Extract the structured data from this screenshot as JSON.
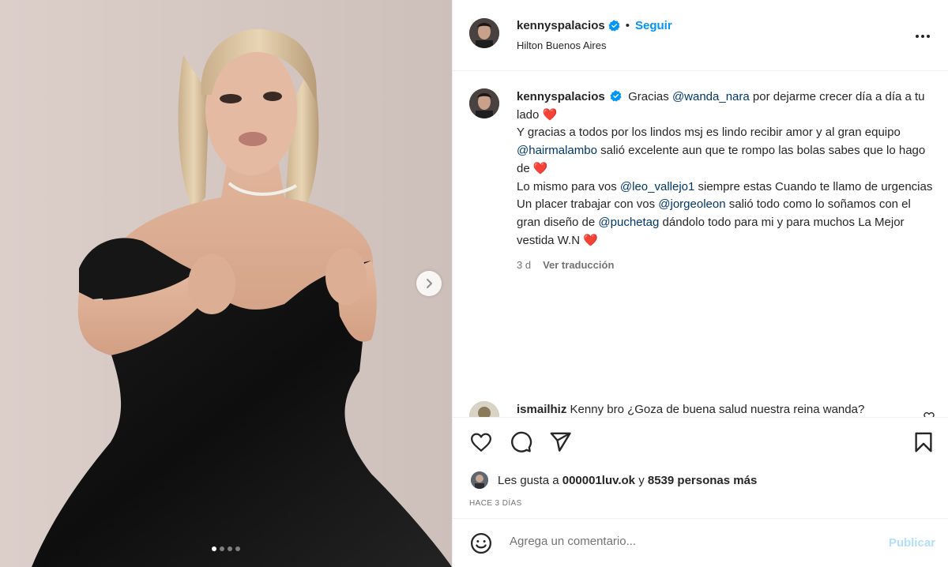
{
  "post": {
    "author": {
      "username": "kennyspalacios",
      "verified": true,
      "follow_label": "Seguir",
      "location": "Hilton Buenos Aires",
      "separator": "•"
    },
    "caption": {
      "username": "kennyspalacios",
      "segments": [
        {
          "type": "text",
          "value": "Gracias "
        },
        {
          "type": "mention",
          "value": "@wanda_nara"
        },
        {
          "type": "text",
          "value": " por dejarme crecer día a día a tu lado "
        },
        {
          "type": "emoji",
          "value": "❤️"
        },
        {
          "type": "br"
        },
        {
          "type": "text",
          "value": "Y gracias a todos por los lindos msj es lindo recibir amor y al gran equipo"
        },
        {
          "type": "br"
        },
        {
          "type": "mention",
          "value": "@hairmalambo"
        },
        {
          "type": "text",
          "value": " salió excelente aun que te rompo las bolas sabes que lo hago de "
        },
        {
          "type": "emoji",
          "value": "❤️"
        },
        {
          "type": "br"
        },
        {
          "type": "text",
          "value": "Lo mismo para vos "
        },
        {
          "type": "mention",
          "value": "@leo_vallejo1"
        },
        {
          "type": "text",
          "value": " siempre estas Cuando te llamo de urgencias"
        },
        {
          "type": "br"
        },
        {
          "type": "text",
          "value": "Un placer trabajar con vos "
        },
        {
          "type": "mention",
          "value": "@jorgeoleon"
        },
        {
          "type": "text",
          "value": " salió todo como lo soñamos con el gran diseño de "
        },
        {
          "type": "mention",
          "value": "@puchetag"
        },
        {
          "type": "text",
          "value": " dándolo todo para mi y para muchos La Mejor vestida W.N "
        },
        {
          "type": "emoji",
          "value": "❤️"
        }
      ],
      "age": "3 d",
      "see_translation": "Ver traducción"
    },
    "comments": [
      {
        "username": "ismailhiz",
        "text": "Kenny bro ¿Goza de buena salud nuestra reina wanda? Estamos muy emocionados por las noticias escritas en la prensa.... Deseamos mucha salud a nuestra Reina... La queremos mucho a ella y a los niños... Que Dios le de salud..."
      }
    ],
    "likes": {
      "prefix": "Les gusta a ",
      "first_user": "000001luv.ok",
      "middle": " y ",
      "others": "8539 personas más"
    },
    "time_ago": "HACE 3 DÍAS",
    "add_comment": {
      "placeholder": "Agrega un comentario...",
      "post_label": "Publicar"
    },
    "carousel": {
      "total": 4,
      "current": 1
    },
    "icons": {
      "more": "more-horizontal-icon",
      "like": "heart-outline-icon",
      "comment": "comment-bubble-icon",
      "share": "paper-plane-icon",
      "save": "bookmark-icon",
      "emoji": "smiley-icon",
      "next": "chevron-right-icon"
    },
    "colors": {
      "link": "#0095f6",
      "mention": "#00376b",
      "verified": "#0095f6",
      "heart": "#e02424",
      "muted": "#737373"
    }
  }
}
